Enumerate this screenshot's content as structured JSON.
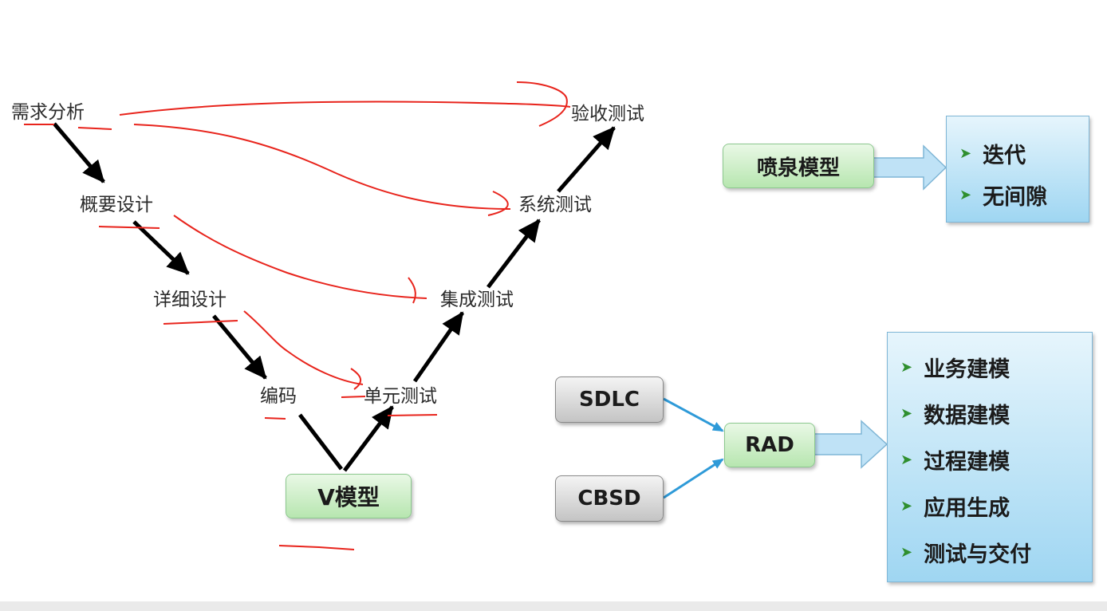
{
  "v_model": {
    "stages_left": [
      {
        "id": "req",
        "label": "需求分析"
      },
      {
        "id": "outline",
        "label": "概要设计"
      },
      {
        "id": "detail",
        "label": "详细设计"
      },
      {
        "id": "code",
        "label": "编码"
      }
    ],
    "stages_right": [
      {
        "id": "unit",
        "label": "单元测试"
      },
      {
        "id": "integration",
        "label": "集成测试"
      },
      {
        "id": "system",
        "label": "系统测试"
      },
      {
        "id": "acceptance",
        "label": "验收测试"
      }
    ],
    "box_label": "V模型"
  },
  "fountain": {
    "box_label": "喷泉模型",
    "items": [
      "迭代",
      "无间隙"
    ]
  },
  "rad": {
    "inputs": [
      "SDLC",
      "CBSD"
    ],
    "box_label": "RAD",
    "items": [
      "业务建模",
      "数据建模",
      "过程建模",
      "应用生成",
      "测试与交付"
    ]
  },
  "colors": {
    "green_box": "#b7e6b0",
    "gray_box": "#c4c4c4",
    "blue_box": "#9fd6f2",
    "annotation_red": "#e8241c",
    "connector_blue": "#2e9ad8",
    "bullet_green": "#2f8f2f"
  }
}
